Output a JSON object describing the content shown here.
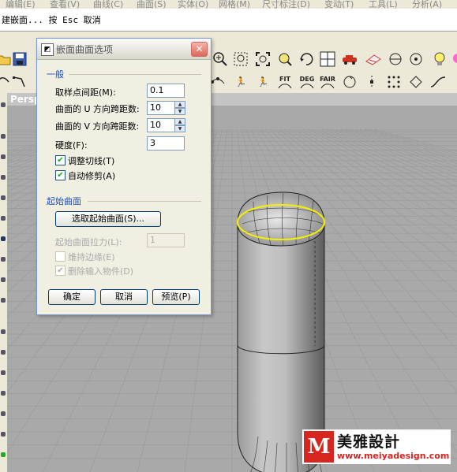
{
  "menu": [
    "编辑(E)",
    "查看(V)",
    "曲线(C)",
    "曲面(S)",
    "实体(O)",
    "网格(M)",
    "尺寸标注(D)",
    "变动(T)",
    "工具(L)",
    "分析(A)"
  ],
  "command_prompt": "建嵌面... 按 Esc 取消",
  "toolbar_text_buttons": [
    "FIT",
    "DEG",
    "FAIR"
  ],
  "viewport": {
    "title": "Persp"
  },
  "dialog": {
    "title": "嵌面曲面选项",
    "close": "✕",
    "section_general": "一般",
    "sample_spacing_label": "取样点间距(M):",
    "sample_spacing_value": "0.1",
    "u_span_label": "曲面的 U 方向跨距数:",
    "u_span_value": "10",
    "v_span_label": "曲面的 V 方向跨距数:",
    "v_span_value": "10",
    "stiffness_label": "硬度(F):",
    "stiffness_value": "3",
    "adjust_tangency_label": "调整切线(T)",
    "adjust_tangency_checked": true,
    "auto_trim_label": "自动修剪(A)",
    "auto_trim_checked": true,
    "section_starting": "起始曲面",
    "select_start_surface_button": "选取起始曲面(S)...",
    "start_surface_pull_label": "起始曲面拉力(L):",
    "start_surface_pull_value": "1",
    "preserve_edges_label": "维持边缘(E)",
    "preserve_edges_checked": false,
    "delete_input_label": "删除输入物件(D)",
    "delete_input_checked": true,
    "ok_button": "确定",
    "cancel_button": "取消",
    "preview_button": "预览(P)"
  },
  "watermark": {
    "mark": "M",
    "name": "美雅設計",
    "url": "www.meiyadesign.com"
  },
  "colors": {
    "selection": "#f4f000",
    "link_blue": "#1a4fbf",
    "logo_red": "#d7261f"
  }
}
